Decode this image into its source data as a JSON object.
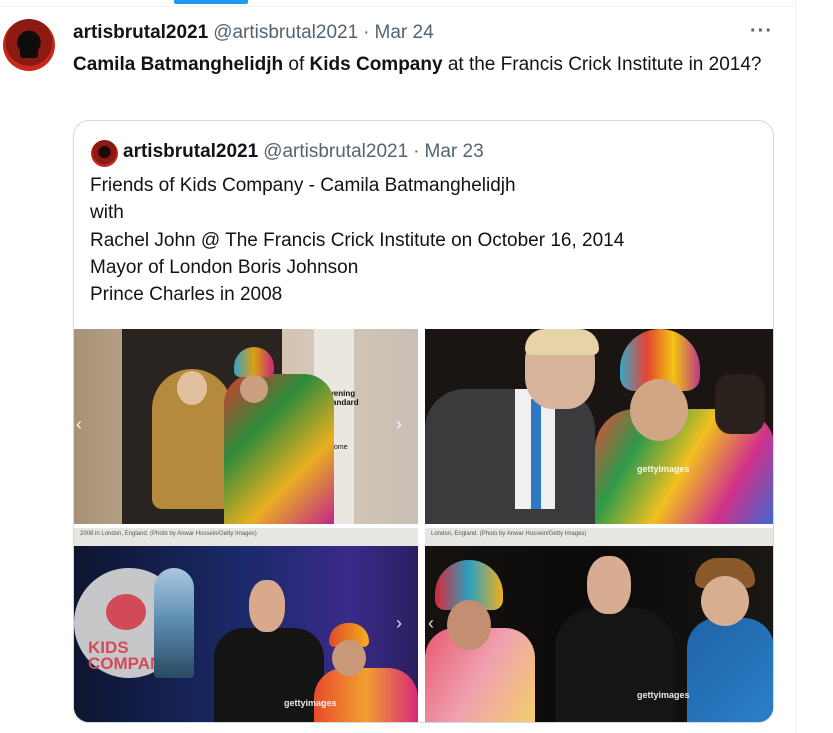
{
  "tweet": {
    "author_name": "artisbrutal2021",
    "author_handle": "@artisbrutal2021",
    "separator": "·",
    "date": "Mar 24",
    "more_icon": "more-horizontal-icon",
    "text_parts": {
      "p1": "Camila Batmanghelidjh",
      "p2": " of ",
      "p3": "Kids Company",
      "p4": " at the Francis Crick Institute in 2014?"
    }
  },
  "quoted": {
    "author_name": "artisbrutal2021",
    "author_handle": "@artisbrutal2021",
    "separator": "·",
    "date": "Mar 23",
    "lines": [
      "Friends of Kids Company -  Camila Batmanghelidjh",
      "with",
      "Rachel John @ The Francis Crick Institute on October 16, 2014",
      "Mayor of London Boris Johnson",
      "Prince Charles in 2008"
    ],
    "photos": {
      "p1_sign": "Evening Standard",
      "p1_sign_small": "welcome",
      "p2_watermark": "gettyimages",
      "p3_logo": "KIDS COMPANY",
      "p3_watermark": "gettyimages",
      "p4_watermark": "gettyimages",
      "p3_caption": "2008 in London, England. (Photo by Anwar Hussein/Getty Images)",
      "p4_caption": "London, England. (Photo by Anwar Hussein/Getty Images)"
    }
  },
  "colors": {
    "accent": "#1d9bf0",
    "text": "#0f1419",
    "secondary": "#536471",
    "border": "#cfd9de"
  }
}
